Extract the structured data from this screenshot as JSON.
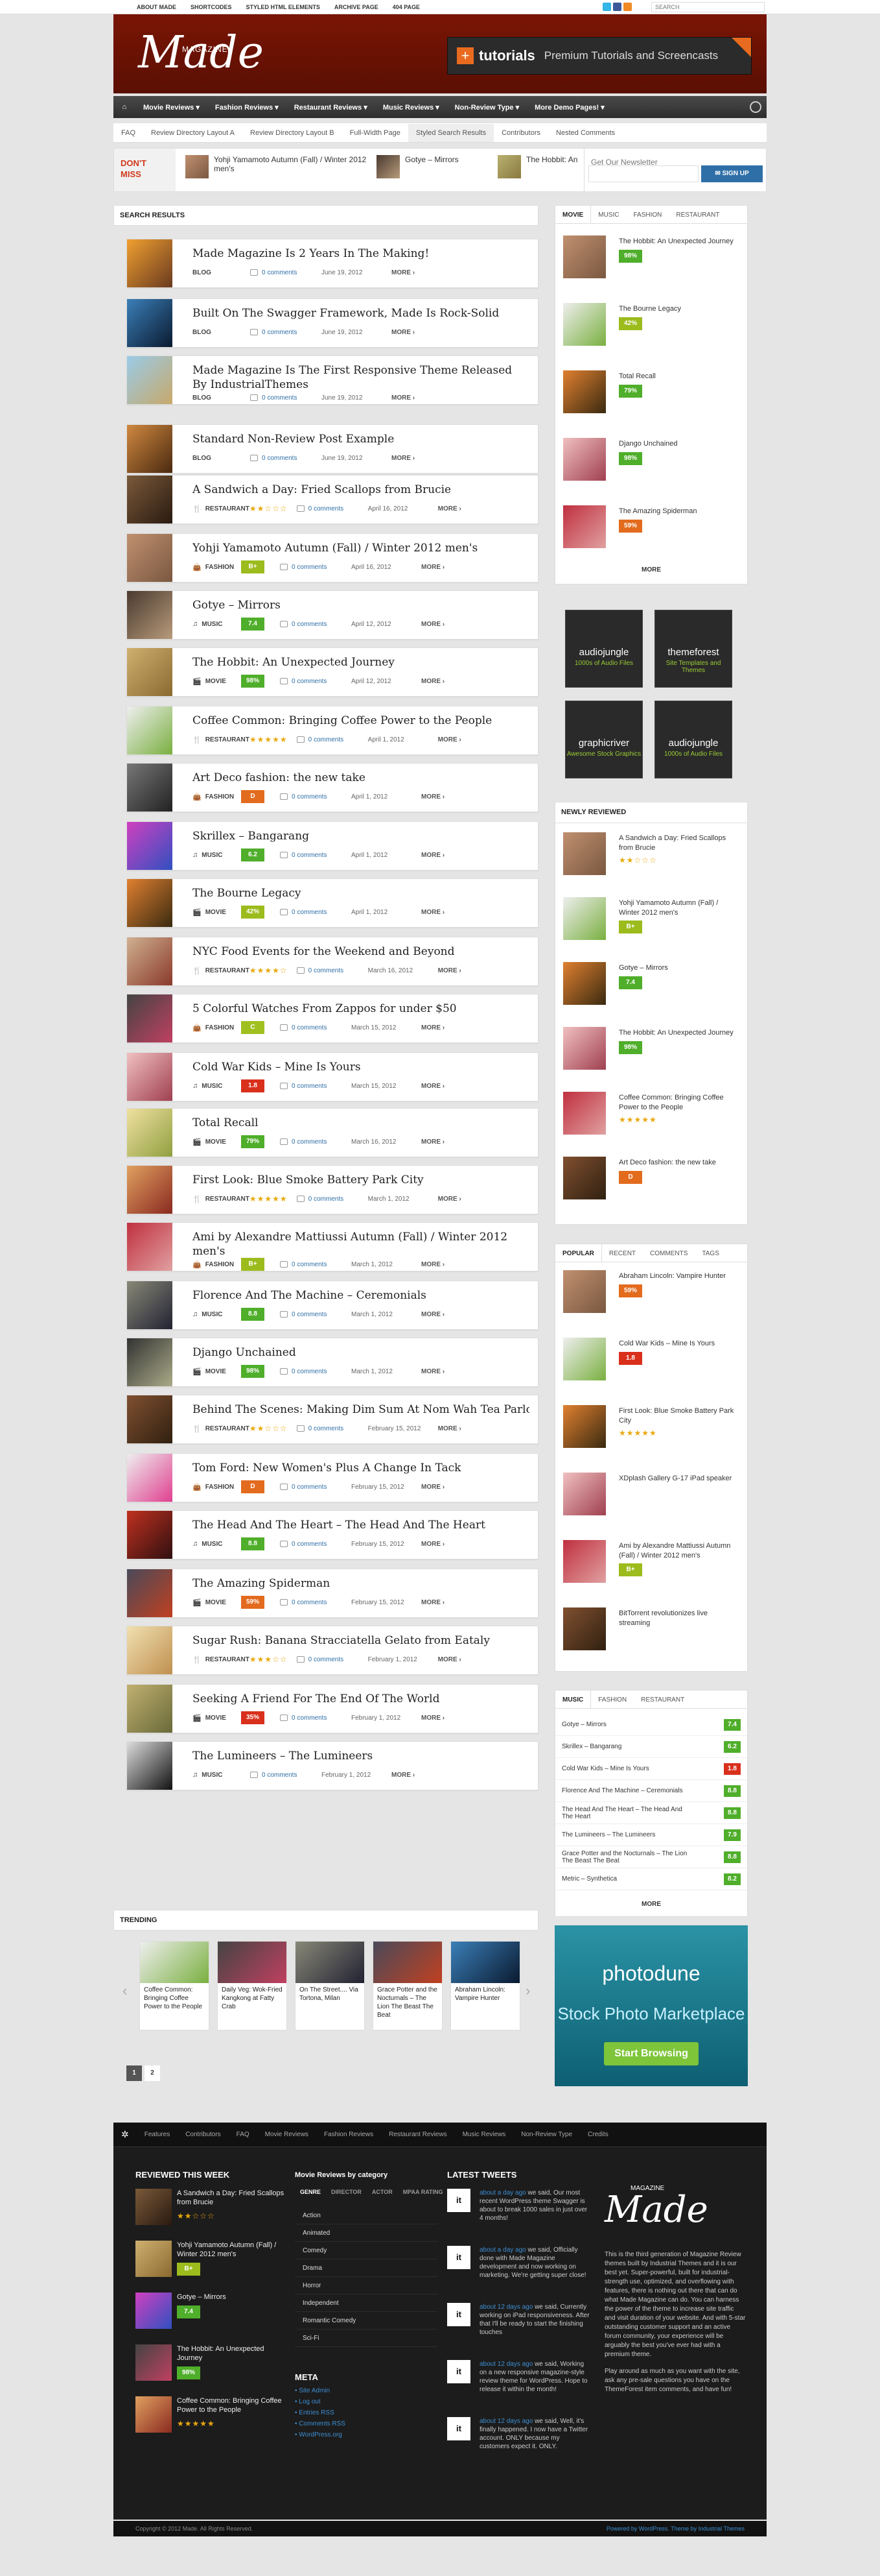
{
  "topbar": {
    "menu": [
      "About Made",
      "Shortcodes",
      "Styled HTML Elements",
      "Archive Page",
      "404 Page"
    ],
    "search_placeholder": "SEARCH"
  },
  "header": {
    "logo": "Made",
    "logo_small": "MAGAZINE",
    "banner_brand": "tutorials",
    "banner_text": "Premium Tutorials and Screencasts"
  },
  "mainnav": [
    "Movie Reviews",
    "Fashion Reviews",
    "Restaurant Reviews",
    "Music Reviews",
    "Non-Review Type",
    "More Demo Pages!"
  ],
  "subnav": [
    "FAQ",
    "Review Directory Layout A",
    "Review Directory Layout B",
    "Full-Width Page",
    "Styled Search Results",
    "Contributors",
    "Nested Comments"
  ],
  "dontmiss": {
    "label1": "DON'T",
    "label2": "MISS",
    "items": [
      "Yohji Yamamoto Autumn (Fall) / Winter 2012 men's",
      "Gotye – Mirrors",
      "The Hobbit: An"
    ]
  },
  "newsletter": {
    "title": "Get Our Newsletter",
    "button": "SIGN UP"
  },
  "search_results": {
    "title": "Search Results",
    "more": "MORE ›",
    "items": [
      {
        "title": "Made Magazine Is 2 Years In The Making!",
        "cat": "BLOG",
        "rating": "",
        "comments": "0 comments",
        "date": "June 19, 2012"
      },
      {
        "title": "Built On The Swagger Framework, Made Is Rock-Solid",
        "cat": "BLOG",
        "rating": "",
        "comments": "0 comments",
        "date": "June 19, 2012"
      },
      {
        "title": "Made Magazine Is The First Responsive Theme Released By IndustrialThemes",
        "cat": "BLOG",
        "rating": "",
        "comments": "0 comments",
        "date": "June 19, 2012"
      },
      {
        "title": "Standard Non-Review Post Example",
        "cat": "BLOG",
        "rating": "",
        "comments": "0 comments",
        "date": "June 19, 2012"
      },
      {
        "title": "A Sandwich a Day: Fried Scallops from Brucie",
        "cat": "RESTAURANT",
        "rating": "★★☆☆☆",
        "comments": "0 comments",
        "date": "April 16, 2012"
      },
      {
        "title": "Yohji Yamamoto Autumn (Fall) / Winter 2012 men's",
        "cat": "FASHION",
        "rating": "B+",
        "comments": "0 comments",
        "date": "April 16, 2012"
      },
      {
        "title": "Gotye – Mirrors",
        "cat": "MUSIC",
        "rating": "7.4",
        "comments": "0 comments",
        "date": "April 12, 2012"
      },
      {
        "title": "The Hobbit: An Unexpected Journey",
        "cat": "MOVIE",
        "rating": "98%",
        "comments": "0 comments",
        "date": "April 12, 2012"
      },
      {
        "title": "Coffee Common: Bringing Coffee Power to the People",
        "cat": "RESTAURANT",
        "rating": "★★★★★",
        "comments": "0 comments",
        "date": "April 1, 2012"
      },
      {
        "title": "Art Deco fashion: the new take",
        "cat": "FASHION",
        "rating": "D",
        "comments": "0 comments",
        "date": "April 1, 2012"
      },
      {
        "title": "Skrillex – Bangarang",
        "cat": "MUSIC",
        "rating": "6.2",
        "comments": "0 comments",
        "date": "April 1, 2012"
      },
      {
        "title": "The Bourne Legacy",
        "cat": "MOVIE",
        "rating": "42%",
        "comments": "0 comments",
        "date": "April 1, 2012"
      },
      {
        "title": "NYC Food Events for the Weekend and Beyond",
        "cat": "RESTAURANT",
        "rating": "★★★★☆",
        "comments": "0 comments",
        "date": "March 16, 2012"
      },
      {
        "title": "5 Colorful Watches From Zappos for under $50",
        "cat": "FASHION",
        "rating": "C",
        "comments": "0 comments",
        "date": "March 15, 2012"
      },
      {
        "title": "Cold War Kids – Mine Is Yours",
        "cat": "MUSIC",
        "rating": "1.8",
        "comments": "0 comments",
        "date": "March 15, 2012"
      },
      {
        "title": "Total Recall",
        "cat": "MOVIE",
        "rating": "79%",
        "comments": "0 comments",
        "date": "March 16, 2012"
      },
      {
        "title": "First Look: Blue Smoke Battery Park City",
        "cat": "RESTAURANT",
        "rating": "★★★★★",
        "comments": "0 comments",
        "date": "March 1, 2012"
      },
      {
        "title": "Ami by Alexandre Mattiussi Autumn (Fall) / Winter 2012 men's",
        "cat": "FASHION",
        "rating": "B+",
        "comments": "0 comments",
        "date": "March 1, 2012"
      },
      {
        "title": "Florence And The Machine – Ceremonials",
        "cat": "MUSIC",
        "rating": "8.8",
        "comments": "0 comments",
        "date": "March 1, 2012"
      },
      {
        "title": "Django Unchained",
        "cat": "MOVIE",
        "rating": "98%",
        "comments": "0 comments",
        "date": "March 1, 2012"
      },
      {
        "title": "Behind The Scenes: Making Dim Sum At Nom Wah Tea Parlor",
        "cat": "RESTAURANT",
        "rating": "★★☆☆☆",
        "comments": "0 comments",
        "date": "February 15, 2012"
      },
      {
        "title": "Tom Ford: New Women's Plus A Change In Tack",
        "cat": "FASHION",
        "rating": "D",
        "comments": "0 comments",
        "date": "February 15, 2012"
      },
      {
        "title": "The Head And The Heart – The Head And The Heart",
        "cat": "MUSIC",
        "rating": "8.8",
        "comments": "0 comments",
        "date": "February 15, 2012"
      },
      {
        "title": "The Amazing Spiderman",
        "cat": "MOVIE",
        "rating": "59%",
        "comments": "0 comments",
        "date": "February 15, 2012"
      },
      {
        "title": "Sugar Rush: Banana Stracciatella Gelato from Eataly",
        "cat": "RESTAURANT",
        "rating": "★★★☆☆",
        "comments": "0 comments",
        "date": "February 1, 2012"
      },
      {
        "title": "Seeking A Friend For The End Of The World",
        "cat": "MOVIE",
        "rating": "35%",
        "comments": "0 comments",
        "date": "February 1, 2012"
      },
      {
        "title": "The Lumineers – The Lumineers",
        "cat": "MUSIC",
        "rating": "",
        "comments": "0 comments",
        "date": "February 1, 2012"
      }
    ]
  },
  "pager": [
    "1",
    "2"
  ],
  "sidebar": {
    "tabs1": [
      "Movie",
      "Music",
      "Fashion",
      "Restaurant"
    ],
    "movies": [
      {
        "title": "The Hobbit: An Unexpected Journey",
        "rating": "98%"
      },
      {
        "title": "The Bourne Legacy",
        "rating": "42%"
      },
      {
        "title": "Total Recall",
        "rating": "79%"
      },
      {
        "title": "Django Unchained",
        "rating": "98%"
      },
      {
        "title": "The Amazing Spiderman",
        "rating": "59%"
      }
    ],
    "more": "MORE",
    "ads": [
      {
        "name": "audiojungle",
        "sub": "1000s of Audio Files"
      },
      {
        "name": "themeforest",
        "sub": "Site Templates and Themes"
      },
      {
        "name": "graphicriver",
        "sub": "Awesome Stock Graphics"
      },
      {
        "name": "audiojungle",
        "sub": "1000s of Audio Files"
      }
    ],
    "newly_title": "Newly Reviewed",
    "newly": [
      {
        "title": "A Sandwich a Day: Fried Scallops from Brucie",
        "rating": "★★☆☆☆"
      },
      {
        "title": "Yohji Yamamoto Autumn (Fall) / Winter 2012 men's",
        "rating": "B+"
      },
      {
        "title": "Gotye – Mirrors",
        "rating": "7.4"
      },
      {
        "title": "The Hobbit: An Unexpected Journey",
        "rating": "98%"
      },
      {
        "title": "Coffee Common: Bringing Coffee Power to the People",
        "rating": "★★★★★"
      },
      {
        "title": "Art Deco fashion: the new take",
        "rating": "D"
      }
    ],
    "tabs2": [
      "Popular",
      "Recent",
      "Comments",
      "Tags"
    ],
    "popular": [
      {
        "title": "Abraham Lincoln: Vampire Hunter",
        "rating": "59%"
      },
      {
        "title": "Cold War Kids – Mine Is Yours",
        "rating": "1.8"
      },
      {
        "title": "First Look: Blue Smoke Battery Park City",
        "rating": "★★★★★"
      },
      {
        "title": "XDplash Gallery G-17 iPad speaker",
        "rating": ""
      },
      {
        "title": "Ami by Alexandre Mattiussi Autumn (Fall) / Winter 2012 men's",
        "rating": "B+"
      },
      {
        "title": "BitTorrent revolutionizes live streaming",
        "rating": ""
      }
    ],
    "tabs3": [
      "Music",
      "Fashion",
      "Restaurant"
    ],
    "music": [
      {
        "title": "Gotye – Mirrors",
        "rating": "7.4"
      },
      {
        "title": "Skrillex – Bangarang",
        "rating": "6.2"
      },
      {
        "title": "Cold War Kids – Mine Is Yours",
        "rating": "1.8"
      },
      {
        "title": "Florence And The Machine – Ceremonials",
        "rating": "8.8"
      },
      {
        "title": "The Head And The Heart – The Head And The Heart",
        "rating": "8.8"
      },
      {
        "title": "The Lumineers – The Lumineers",
        "rating": "7.9"
      },
      {
        "title": "Grace Potter and the Nocturnals – The Lion The Beast The Beat",
        "rating": "8.8"
      },
      {
        "title": "Metric – Synthetica",
        "rating": "8.2"
      }
    ]
  },
  "trending": {
    "title": "Trending",
    "items": [
      "Coffee Common: Bringing Coffee Power to the People",
      "Daily Veg: Wok-Fried Kangkong at Fatty Crab",
      "On The Street.... Via Tortona, Milan",
      "Grace Potter and the Nocturnals – The Lion The Beast The Beat",
      "Abraham Lincoln: Vampire Hunter"
    ]
  },
  "photodune": {
    "brand": "photodune",
    "tag": "Stock Photo Marketplace",
    "button": "Start Browsing"
  },
  "footer": {
    "nav": [
      "Features",
      "Contributors",
      "FAQ",
      "Movie Reviews",
      "Fashion Reviews",
      "Restaurant Reviews",
      "Music Reviews",
      "Non-Review Type",
      "Credits"
    ],
    "reviewed_title": "Reviewed This Week",
    "reviewed": [
      {
        "title": "A Sandwich a Day: Fried Scallops from Brucie",
        "rating": "★★☆☆☆"
      },
      {
        "title": "Yohji Yamamoto Autumn (Fall) / Winter 2012 men's",
        "rating": "B+"
      },
      {
        "title": "Gotye – Mirrors",
        "rating": "7.4"
      },
      {
        "title": "The Hobbit: An Unexpected Journey",
        "rating": "98%"
      },
      {
        "title": "Coffee Common: Bringing Coffee Power to the People",
        "rating": "★★★★★"
      }
    ],
    "cat_title": "Movie Reviews by category",
    "cat_tabs": [
      "Genre",
      "Director",
      "Actor",
      "MPAA Rating"
    ],
    "cats": [
      "Action",
      "Animated",
      "Comedy",
      "Drama",
      "Horror",
      "Independent",
      "Romantic Comedy",
      "Sci-Fi"
    ],
    "meta_title": "Meta",
    "meta": [
      "Site Admin",
      "Log out",
      "Entries RSS",
      "Comments RSS",
      "WordPress.org"
    ],
    "tweets_title": "Latest Tweets",
    "tweets": [
      {
        "time": "about a day ago",
        "text": "we said, Our most recent WordPress theme Swagger is about to break 1000 sales in just over 4 months!"
      },
      {
        "time": "about a day ago",
        "text": "we said, Officially done with Made Magazine development and now working on marketing. We're getting super close!"
      },
      {
        "time": "about 12 days ago",
        "text": "we said, Currently working on iPad responsiveness. After that I'll be ready to start the finishing touches"
      },
      {
        "time": "about 12 days ago",
        "text": "we said, Working on a new responsive magazine-style review theme for WordPress. Hope to release it within the month!"
      },
      {
        "time": "about 12 days ago",
        "text": "we said, Well, it's finally happened. I now have a Twitter account. ONLY because my customers expect it. ONLY."
      }
    ],
    "about_logo": "Made",
    "about_small": "MAGAZINE",
    "about1": "This is the third generation of Magazine Review themes built by Industrial Themes and it is our best yet. Super-powerful, built for industrial-strength use, optimized, and overflowing with features, there is nothing out there that can do what Made Magazine can do. You can harness the power of the theme to increase site traffic and visit duration of your website. And with 5-star outstanding customer support and an active forum community, your experience will be arguably the best you've ever had with a premium theme.",
    "about2": "Play around as much as you want with the site, ask any pre-sale questions you have on the ThemeForest item comments, and have fun!",
    "copyright": "Copyright © 2012 Made. All Rights Reserved.",
    "powered": "Powered by WordPress. Theme by Industrial Themes"
  },
  "colors": {
    "accent": "#7a1505",
    "blue": "#2f6fa7",
    "green": "#4fae2a",
    "orange": "#e36b1e",
    "red": "#d9301c",
    "yellowgreen": "#9cbb1c"
  }
}
